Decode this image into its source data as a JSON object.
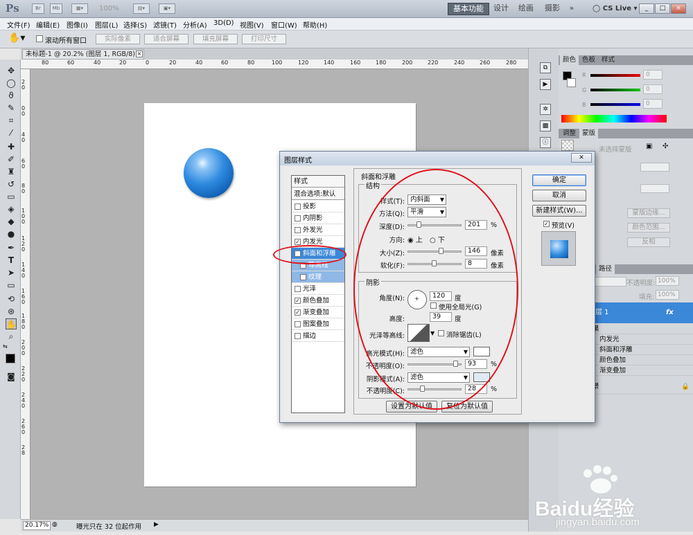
{
  "app": {
    "logo": "Ps",
    "zoom": "100%",
    "workspaces": [
      "基本功能",
      "设计",
      "绘画",
      "摄影"
    ],
    "more_label": "»",
    "cslive": "CS Live",
    "win_controls": [
      "_",
      "□",
      "×"
    ]
  },
  "menu": [
    "文件(F)",
    "编辑(E)",
    "图像(I)",
    "图层(L)",
    "选择(S)",
    "滤镜(T)",
    "分析(A)",
    "3D(D)",
    "视图(V)",
    "窗口(W)",
    "帮助(H)"
  ],
  "options": {
    "scroll_all": "滚动所有窗口",
    "buttons": [
      "实际像素",
      "适合屏幕",
      "填充屏幕",
      "打印尺寸"
    ]
  },
  "document": {
    "tab_title": "未标题-1 @ 20.2% (图层 1, RGB/8) *",
    "tab_close": "×",
    "ruler_top": [
      "80",
      "60",
      "40",
      "20",
      "0",
      "20",
      "40",
      "60",
      "80",
      "100",
      "120",
      "140",
      "160",
      "180",
      "200",
      "220",
      "240",
      "260",
      "280"
    ],
    "ruler_left": [
      "2",
      "0",
      "2",
      "0",
      "4",
      "0",
      "6",
      "0",
      "8",
      "0",
      "1",
      "0",
      "0",
      "1",
      "2",
      "0",
      "1",
      "4",
      "0",
      "1",
      "6",
      "0",
      "1",
      "8",
      "0",
      "2",
      "0",
      "0",
      "2",
      "2",
      "0",
      "2",
      "4",
      "0",
      "2",
      "6",
      "0",
      "2",
      "8"
    ]
  },
  "status": {
    "zoom": "20.17%",
    "info": "曝光只在 32 位起作用"
  },
  "panels": {
    "color_tabs": [
      "颜色",
      "色板",
      "样式"
    ],
    "rgb_labels": [
      "R",
      "G",
      "B"
    ],
    "rgb_values": [
      "0",
      "0",
      "0"
    ],
    "adjust_tabs": [
      "调整",
      "蒙版"
    ],
    "mask_label": "未选择蒙版",
    "mask_buttons": [
      "蒙版边缘...",
      "颜色范围...",
      "反相"
    ],
    "layers_tab": "路径",
    "opacity_label": "不透明度:",
    "opacity_value": "100%",
    "fill_label": "填充:",
    "fill_value": "100%",
    "layer_name": "层 1",
    "fx": "fx",
    "effects_head": "果",
    "effects": [
      "内发光",
      "斜面和浮雕",
      "颜色叠加",
      "渐变叠加"
    ],
    "background": "景"
  },
  "dialog": {
    "title": "图层样式",
    "close": "✕",
    "style_head": "样式",
    "blend_default": "混合选项:默认",
    "styles": [
      {
        "label": "投影",
        "checked": false
      },
      {
        "label": "内阴影",
        "checked": false
      },
      {
        "label": "外发光",
        "checked": false
      },
      {
        "label": "内发光",
        "checked": true
      },
      {
        "label": "斜面和浮雕",
        "checked": true
      },
      {
        "label": "等高线",
        "checked": false
      },
      {
        "label": "纹理",
        "checked": false
      },
      {
        "label": "光泽",
        "checked": false
      },
      {
        "label": "颜色叠加",
        "checked": true
      },
      {
        "label": "渐变叠加",
        "checked": true
      },
      {
        "label": "图案叠加",
        "checked": false
      },
      {
        "label": "描边",
        "checked": false
      }
    ],
    "bevel_title": "斜面和浮雕",
    "structure_title": "结构",
    "style_label": "样式(T):",
    "style_value": "内斜面",
    "method_label": "方法(Q):",
    "method_value": "平滑",
    "depth_label": "深度(D):",
    "depth_value": "201",
    "depth_unit": "%",
    "direction_label": "方向:",
    "dir_up": "上",
    "dir_down": "下",
    "size_label": "大小(Z):",
    "size_value": "146",
    "size_unit": "像素",
    "soften_label": "软化(F):",
    "soften_value": "8",
    "soften_unit": "像素",
    "shading_title": "阴影",
    "angle_label": "角度(N):",
    "angle_value": "120",
    "angle_unit": "度",
    "global_light": "使用全局光(G)",
    "altitude_label": "高度:",
    "altitude_value": "39",
    "altitude_unit": "度",
    "gloss_label": "光泽等高线:",
    "anti_alias": "消除锯齿(L)",
    "highlight_label": "高光模式(H):",
    "highlight_value": "滤色",
    "hl_opacity_label": "不透明度(O):",
    "hl_opacity_value": "93",
    "hl_opacity_unit": "%",
    "shadow_label": "阴影模式(A):",
    "shadow_value": "滤色",
    "sh_opacity_label": "不透明度(C):",
    "sh_opacity_value": "28",
    "sh_opacity_unit": "%",
    "make_default": "设置为默认值",
    "reset_default": "复位为默认值",
    "ok": "确定",
    "cancel": "取消",
    "new_style": "新建样式(W)...",
    "preview": "预览(V)"
  },
  "watermark": {
    "brand": "Baidu经验",
    "url": "jingyan.baidu.com"
  },
  "colors": {
    "accent": "#3b87d8",
    "annotation": "#e0101a",
    "sphere": "#2f8be0"
  }
}
